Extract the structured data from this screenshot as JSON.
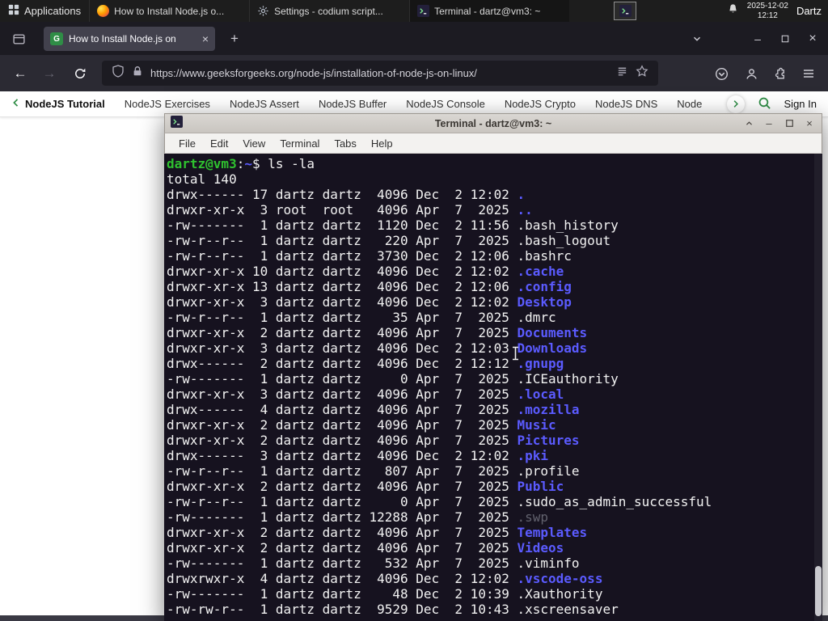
{
  "colors": {
    "gfg_green": "#2f8d46",
    "terminal_dir_blue": "#5b5bff",
    "terminal_prompt_green": "#2fc22f",
    "firefox_dark": "#1c1b22",
    "firefox_toolbar": "#2b2a33"
  },
  "icons": {
    "close": "×",
    "minimize": "–",
    "new_tab": "+",
    "back_arrow": "←",
    "forward_arrow": "→"
  },
  "taskbar": {
    "applications_label": "Applications",
    "windows": [
      {
        "title": "How to Install Node.js o...",
        "icon": "firefox-icon"
      },
      {
        "title": "Settings - codium script...",
        "icon": "settings-icon"
      },
      {
        "title": "Terminal - dartz@vm3: ~",
        "icon": "terminal-icon"
      }
    ],
    "date": "2025-12-02",
    "time": "12:12",
    "user": "Dartz"
  },
  "browser": {
    "tab_title": "How to Install Node.js on",
    "favicon_letter": "G",
    "url": "https://www.geeksforgeeks.org/node-js/installation-of-node-js-on-linux/"
  },
  "site_nav": {
    "back_label": "NodeJS Tutorial",
    "links": [
      "NodeJS Exercises",
      "NodeJS Assert",
      "NodeJS Buffer",
      "NodeJS Console",
      "NodeJS Crypto",
      "NodeJS DNS",
      "Node"
    ],
    "sign_in_label": "Sign In"
  },
  "terminal": {
    "window_title": "Terminal - dartz@vm3: ~",
    "menu": [
      "File",
      "Edit",
      "View",
      "Terminal",
      "Tabs",
      "Help"
    ],
    "prompt": {
      "user_host": "dartz@vm3",
      "colon": ":",
      "path": "~",
      "dollar": "$ ",
      "command": "ls -la"
    },
    "total_line": "total 140",
    "listing": [
      {
        "pre": "drwx------ 17 dartz dartz  4096 Dec  2 12:02 ",
        "name": ".",
        "cls": "dir"
      },
      {
        "pre": "drwxr-xr-x  3 root  root   4096 Apr  7  2025 ",
        "name": "..",
        "cls": "dir"
      },
      {
        "pre": "-rw-------  1 dartz dartz  1120 Dec  2 11:56 ",
        "name": ".bash_history",
        "cls": "file"
      },
      {
        "pre": "-rw-r--r--  1 dartz dartz   220 Apr  7  2025 ",
        "name": ".bash_logout",
        "cls": "file"
      },
      {
        "pre": "-rw-r--r--  1 dartz dartz  3730 Dec  2 12:06 ",
        "name": ".bashrc",
        "cls": "file"
      },
      {
        "pre": "drwxr-xr-x 10 dartz dartz  4096 Dec  2 12:02 ",
        "name": ".cache",
        "cls": "dir"
      },
      {
        "pre": "drwxr-xr-x 13 dartz dartz  4096 Dec  2 12:06 ",
        "name": ".config",
        "cls": "dir"
      },
      {
        "pre": "drwxr-xr-x  3 dartz dartz  4096 Dec  2 12:02 ",
        "name": "Desktop",
        "cls": "dir"
      },
      {
        "pre": "-rw-r--r--  1 dartz dartz    35 Apr  7  2025 ",
        "name": ".dmrc",
        "cls": "file"
      },
      {
        "pre": "drwxr-xr-x  2 dartz dartz  4096 Apr  7  2025 ",
        "name": "Documents",
        "cls": "dir"
      },
      {
        "pre": "drwxr-xr-x  3 dartz dartz  4096 Dec  2 12:03 ",
        "name": "Downloads",
        "cls": "dir"
      },
      {
        "pre": "drwx------  2 dartz dartz  4096 Dec  2 12:12 ",
        "name": ".gnupg",
        "cls": "dir"
      },
      {
        "pre": "-rw-------  1 dartz dartz     0 Apr  7  2025 ",
        "name": ".ICEauthority",
        "cls": "file"
      },
      {
        "pre": "drwxr-xr-x  3 dartz dartz  4096 Apr  7  2025 ",
        "name": ".local",
        "cls": "dir"
      },
      {
        "pre": "drwx------  4 dartz dartz  4096 Apr  7  2025 ",
        "name": ".mozilla",
        "cls": "dir"
      },
      {
        "pre": "drwxr-xr-x  2 dartz dartz  4096 Apr  7  2025 ",
        "name": "Music",
        "cls": "dir"
      },
      {
        "pre": "drwxr-xr-x  2 dartz dartz  4096 Apr  7  2025 ",
        "name": "Pictures",
        "cls": "dir"
      },
      {
        "pre": "drwx------  3 dartz dartz  4096 Dec  2 12:02 ",
        "name": ".pki",
        "cls": "dir"
      },
      {
        "pre": "-rw-r--r--  1 dartz dartz   807 Apr  7  2025 ",
        "name": ".profile",
        "cls": "file"
      },
      {
        "pre": "drwxr-xr-x  2 dartz dartz  4096 Apr  7  2025 ",
        "name": "Public",
        "cls": "dir"
      },
      {
        "pre": "-rw-r--r--  1 dartz dartz     0 Apr  7  2025 ",
        "name": ".sudo_as_admin_successful",
        "cls": "file"
      },
      {
        "pre": "-rw-------  1 dartz dartz 12288 Apr  7  2025 ",
        "name": ".swp",
        "cls": "dim"
      },
      {
        "pre": "drwxr-xr-x  2 dartz dartz  4096 Apr  7  2025 ",
        "name": "Templates",
        "cls": "dir"
      },
      {
        "pre": "drwxr-xr-x  2 dartz dartz  4096 Apr  7  2025 ",
        "name": "Videos",
        "cls": "dir"
      },
      {
        "pre": "-rw-------  1 dartz dartz   532 Apr  7  2025 ",
        "name": ".viminfo",
        "cls": "file"
      },
      {
        "pre": "drwxrwxr-x  4 dartz dartz  4096 Dec  2 12:02 ",
        "name": ".vscode-oss",
        "cls": "dir"
      },
      {
        "pre": "-rw-------  1 dartz dartz    48 Dec  2 10:39 ",
        "name": ".Xauthority",
        "cls": "file"
      },
      {
        "pre": "-rw-rw-r--  1 dartz dartz  9529 Dec  2 10:43 ",
        "name": ".xscreensaver",
        "cls": "file"
      }
    ]
  }
}
